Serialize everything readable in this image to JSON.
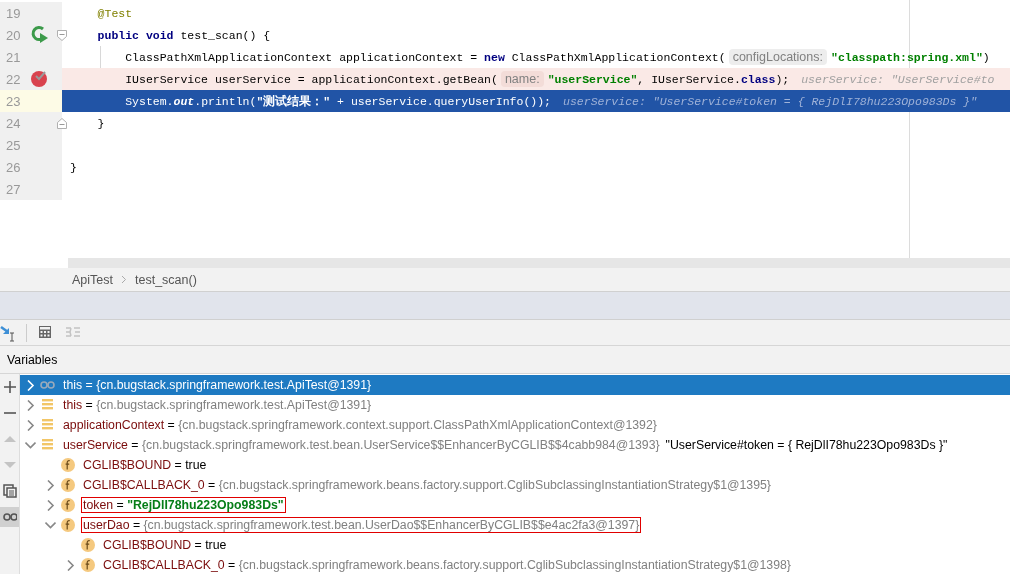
{
  "editor": {
    "lines": [
      {
        "number": "19",
        "kind": "plain",
        "breakpoint": false,
        "current": false,
        "segments": [
          {
            "kind": "annotation",
            "text": "    @Test"
          }
        ]
      },
      {
        "number": "20",
        "kind": "method",
        "breakpoint": false,
        "current": false,
        "segments": [
          {
            "kind": "keyword",
            "text": "    public void"
          },
          {
            "kind": "plain",
            "text": " test_scan() {"
          }
        ]
      },
      {
        "number": "21",
        "kind": "plain",
        "breakpoint": false,
        "current": false,
        "segments": [
          {
            "kind": "plain",
            "text": "        ClassPathXmlApplicationContext applicationContext = "
          },
          {
            "kind": "keyword",
            "text": "new"
          },
          {
            "kind": "plain",
            "text": " ClassPathXmlApplicationContext("
          },
          {
            "kind": "param_hint",
            "text": "configLocations:"
          },
          {
            "kind": "string",
            "text": "\"classpath:spring.xml\""
          },
          {
            "kind": "plain",
            "text": ")"
          }
        ]
      },
      {
        "number": "22",
        "kind": "plain",
        "breakpoint": true,
        "current": false,
        "segments": [
          {
            "kind": "plain",
            "text": "        IUserService userService = applicationContext.getBean("
          },
          {
            "kind": "param_hint",
            "text": "name:"
          },
          {
            "kind": "string",
            "text": "\"userService\""
          },
          {
            "kind": "plain",
            "text": ", IUserService."
          },
          {
            "kind": "keyword",
            "text": "class"
          },
          {
            "kind": "plain",
            "text": ");"
          },
          {
            "kind": "inline_value",
            "text": "userService: \"UserService#to"
          }
        ]
      },
      {
        "number": "23",
        "kind": "plain",
        "breakpoint": false,
        "current": true,
        "segments": [
          {
            "kind": "plain",
            "text": "        System."
          },
          {
            "kind": "static",
            "text": "out"
          },
          {
            "kind": "plain",
            "text": ".println("
          },
          {
            "kind": "string",
            "text": "\"测试结果：\""
          },
          {
            "kind": "plain",
            "text": " + userService.queryUserInfo());"
          },
          {
            "kind": "inline_value",
            "text": "userService: \"UserService#token = { RejDlI78hu223Opo983Ds }\""
          }
        ]
      },
      {
        "number": "24",
        "kind": "block_end",
        "breakpoint": false,
        "current": false,
        "segments": [
          {
            "kind": "plain",
            "text": "    }"
          }
        ]
      },
      {
        "number": "25",
        "kind": "plain",
        "breakpoint": false,
        "current": false
      },
      {
        "number": "26",
        "kind": "plain",
        "breakpoint": false,
        "current": false,
        "segments": [
          {
            "kind": "plain",
            "text": "}"
          }
        ]
      },
      {
        "number": "27",
        "kind": "plain",
        "breakpoint": false,
        "current": false
      }
    ]
  },
  "breadcrumb": [
    "ApiTest",
    "test_scan()"
  ],
  "toolbar": [
    {
      "disabled": false
    },
    {
      "disabled": false
    },
    {
      "disabled": true
    }
  ],
  "variables": {
    "title": "Variables",
    "side_tools": [
      {
        "disabled": false,
        "selected": false
      },
      {
        "disabled": false,
        "selected": false
      },
      {
        "disabled": true,
        "selected": false
      },
      {
        "disabled": true,
        "selected": false
      },
      {
        "disabled": false,
        "selected": false
      },
      {
        "disabled": false,
        "selected": true
      }
    ],
    "items": [
      {
        "kind": "watch",
        "expandable": true,
        "expanded": false,
        "selected": true,
        "boxed": false,
        "name": "this",
        "operator": "=",
        "value": {
          "kind": "object",
          "text": "{cn.bugstack.springframework.test.ApiTest@1391}"
        }
      },
      {
        "kind": "local",
        "expandable": true,
        "expanded": false,
        "selected": false,
        "boxed": false,
        "name": "this",
        "operator": "=",
        "value": {
          "kind": "object",
          "text": "{cn.bugstack.springframework.test.ApiTest@1391}"
        }
      },
      {
        "kind": "local",
        "expandable": true,
        "expanded": false,
        "selected": false,
        "boxed": false,
        "name": "applicationContext",
        "operator": "=",
        "value": {
          "kind": "object",
          "text": "{cn.bugstack.springframework.context.support.ClassPathXmlApplicationContext@1392}"
        }
      },
      {
        "kind": "local",
        "expandable": true,
        "expanded": true,
        "selected": false,
        "boxed": false,
        "name": "userService",
        "operator": "=",
        "value": {
          "kind": "object",
          "text": "{cn.bugstack.springframework.test.bean.UserService$$EnhancerByCGLIB$$4cabb984@1393}"
        },
        "description": "\"UserService#token = { RejDlI78hu223Opo983Ds }\"",
        "children": [
          {
            "kind": "field",
            "expandable": false,
            "selected": false,
            "boxed": false,
            "name": "CGLIB$BOUND",
            "operator": "=",
            "value": {
              "kind": "literal",
              "text": "true"
            }
          },
          {
            "kind": "field",
            "expandable": true,
            "expanded": false,
            "selected": false,
            "boxed": false,
            "name": "CGLIB$CALLBACK_0",
            "operator": "=",
            "value": {
              "kind": "object",
              "text": "{cn.bugstack.springframework.beans.factory.support.CglibSubclassingInstantiationStrategy$1@1395}"
            }
          },
          {
            "kind": "field",
            "expandable": true,
            "expanded": false,
            "selected": false,
            "boxed": true,
            "name": "token",
            "operator": "=",
            "value": {
              "kind": "string",
              "text": "\"RejDlI78hu223Opo983Ds\""
            }
          },
          {
            "kind": "field",
            "expandable": true,
            "expanded": true,
            "selected": false,
            "boxed": true,
            "name": "userDao",
            "operator": "=",
            "value": {
              "kind": "object",
              "text": "{cn.bugstack.springframework.test.bean.UserDao$$EnhancerByCGLIB$$e4ac2fa3@1397}"
            },
            "children": [
              {
                "kind": "field",
                "expandable": false,
                "selected": false,
                "boxed": false,
                "name": "CGLIB$BOUND",
                "operator": "=",
                "value": {
                  "kind": "literal",
                  "text": "true"
                }
              },
              {
                "kind": "field",
                "expandable": true,
                "expanded": false,
                "selected": false,
                "boxed": false,
                "name": "CGLIB$CALLBACK_0",
                "operator": "=",
                "value": {
                  "kind": "object",
                  "text": "{cn.bugstack.springframework.beans.factory.support.CglibSubclassingInstantiationStrategy$1@1398}"
                }
              }
            ]
          }
        ]
      }
    ]
  }
}
